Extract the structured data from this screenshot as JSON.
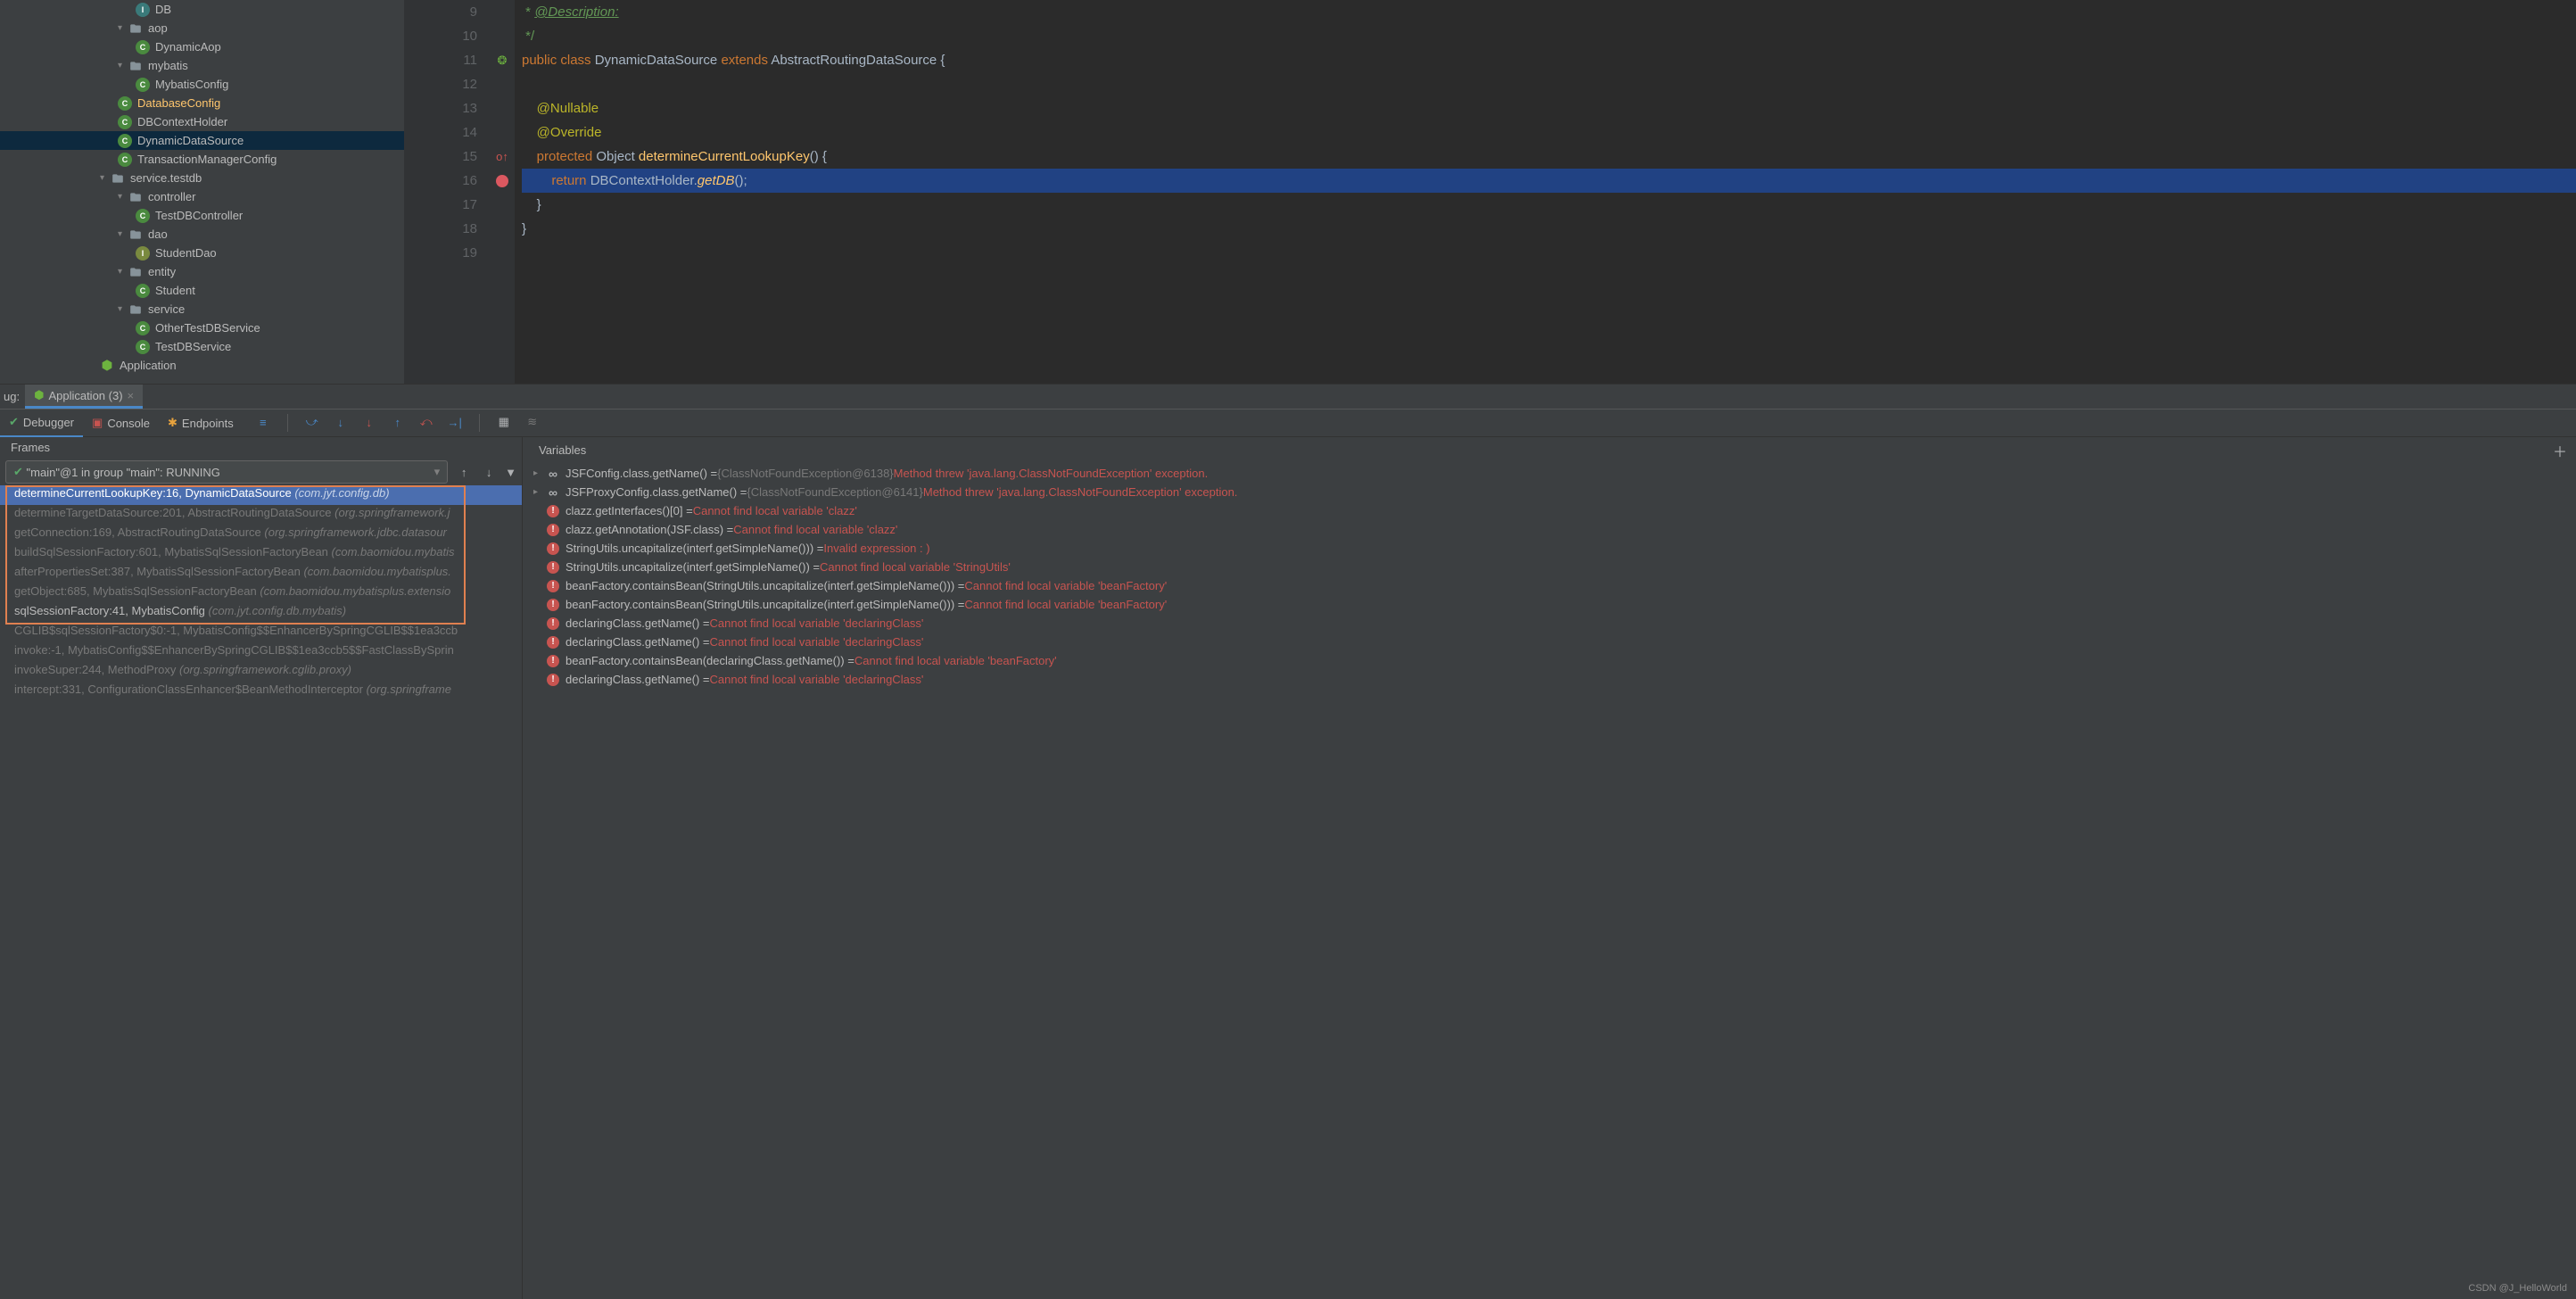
{
  "tree": {
    "db": "DB",
    "aop": "aop",
    "dynamicAop": "DynamicAop",
    "mybatis": "mybatis",
    "mybatisConfig": "MybatisConfig",
    "databaseConfig": "DatabaseConfig",
    "dbContextHolder": "DBContextHolder",
    "dynamicDataSource": "DynamicDataSource",
    "transactionManagerConfig": "TransactionManagerConfig",
    "serviceTestdb": "service.testdb",
    "controller": "controller",
    "testDBController": "TestDBController",
    "dao": "dao",
    "studentDao": "StudentDao",
    "entity": "entity",
    "student": "Student",
    "service": "service",
    "otherTestDBService": "OtherTestDBService",
    "testDBService": "TestDBService",
    "application": "Application"
  },
  "gutter": [
    "9",
    "10",
    "11",
    "12",
    "13",
    "14",
    "15",
    "16",
    "17",
    "18",
    "19"
  ],
  "code": {
    "l9a": " * ",
    "l9b": "@Description:",
    "l10": " */",
    "l11_public": "public ",
    "l11_class": "class ",
    "l11_cls": "DynamicDataSource ",
    "l11_extends": "extends ",
    "l11_super": "AbstractRoutingDataSource {",
    "l12": "",
    "l13": "    @Nullable",
    "l14": "    @Override",
    "l15_prot": "    protected ",
    "l15_obj": "Object ",
    "l15_meth": "determineCurrentLookupKey",
    "l15_end": "() {",
    "l16_ret": "        return ",
    "l16_call": "DBContextHolder.",
    "l16_getdb": "getDB",
    "l16_end": "();",
    "l17": "    }",
    "l18": "}",
    "l19": ""
  },
  "run": {
    "bugLabel": "ug:",
    "appTab": "Application (3)"
  },
  "sub": {
    "debugger": "Debugger",
    "console": "Console",
    "endpoints": "Endpoints"
  },
  "frames": {
    "header": "Frames",
    "thread": "\"main\"@1 in group \"main\": RUNNING",
    "rows": [
      {
        "m": "determineCurrentLookupKey:16, DynamicDataSource",
        "p": "(com.jyt.config.db)",
        "sel": true
      },
      {
        "m": "determineTargetDataSource:201, AbstractRoutingDataSource",
        "p": "(org.springframework.j",
        "faded": true
      },
      {
        "m": "getConnection:169, AbstractRoutingDataSource",
        "p": "(org.springframework.jdbc.datasour",
        "faded": true
      },
      {
        "m": "buildSqlSessionFactory:601, MybatisSqlSessionFactoryBean",
        "p": "(com.baomidou.mybatis",
        "faded": true
      },
      {
        "m": "afterPropertiesSet:387, MybatisSqlSessionFactoryBean",
        "p": "(com.baomidou.mybatisplus.",
        "faded": true
      },
      {
        "m": "getObject:685, MybatisSqlSessionFactoryBean",
        "p": "(com.baomidou.mybatisplus.extensio",
        "faded": true
      },
      {
        "m": "sqlSessionFactory:41, MybatisConfig",
        "p": "(com.jyt.config.db.mybatis)",
        "bold": true
      },
      {
        "m": "CGLIB$sqlSessionFactory$0:-1, MybatisConfig$$EnhancerBySpringCGLIB$$1ea3ccb",
        "p": "",
        "faded": true
      },
      {
        "m": "invoke:-1, MybatisConfig$$EnhancerBySpringCGLIB$$1ea3ccb5$$FastClassBySprin",
        "p": "",
        "faded": true
      },
      {
        "m": "invokeSuper:244, MethodProxy",
        "p": "(org.springframework.cglib.proxy)",
        "faded": true
      },
      {
        "m": "intercept:331, ConfigurationClassEnhancer$BeanMethodInterceptor",
        "p": "(org.springframe",
        "faded": true
      }
    ]
  },
  "vars": {
    "header": "Variables",
    "rows": [
      {
        "t": "inf",
        "expr": "JSFConfig.class.getName() = ",
        "gray": "{ClassNotFoundException@6138} ",
        "red": "Method threw 'java.lang.ClassNotFoundException' exception.",
        "arrow": true
      },
      {
        "t": "inf",
        "expr": "JSFProxyConfig.class.getName() = ",
        "gray": "{ClassNotFoundException@6141} ",
        "red": "Method threw 'java.lang.ClassNotFoundException' exception.",
        "arrow": true
      },
      {
        "t": "err",
        "expr": "clazz.getInterfaces()[0] = ",
        "red": "Cannot find local variable 'clazz'"
      },
      {
        "t": "err",
        "expr": "clazz.getAnnotation(JSF.class) = ",
        "red": "Cannot find local variable 'clazz'"
      },
      {
        "t": "err",
        "expr": "StringUtils.uncapitalize(interf.getSimpleName())) = ",
        "red": "Invalid expression : )"
      },
      {
        "t": "err",
        "expr": "StringUtils.uncapitalize(interf.getSimpleName()) = ",
        "red": "Cannot find local variable 'StringUtils'"
      },
      {
        "t": "err",
        "expr": "beanFactory.containsBean(StringUtils.uncapitalize(interf.getSimpleName())) = ",
        "red": "Cannot find local variable 'beanFactory'"
      },
      {
        "t": "err",
        "expr": "beanFactory.containsBean(StringUtils.uncapitalize(interf.getSimpleName())) = ",
        "red": "Cannot find local variable 'beanFactory'"
      },
      {
        "t": "err",
        "expr": "declaringClass.getName() = ",
        "red": "Cannot find local variable 'declaringClass'"
      },
      {
        "t": "err",
        "expr": "declaringClass.getName() = ",
        "red": "Cannot find local variable 'declaringClass'"
      },
      {
        "t": "err",
        "expr": "beanFactory.containsBean(declaringClass.getName()) = ",
        "red": "Cannot find local variable 'beanFactory'"
      },
      {
        "t": "err",
        "expr": "declaringClass.getName() = ",
        "red": "Cannot find local variable 'declaringClass'"
      }
    ]
  },
  "watermark": "CSDN @J_HelloWorld"
}
